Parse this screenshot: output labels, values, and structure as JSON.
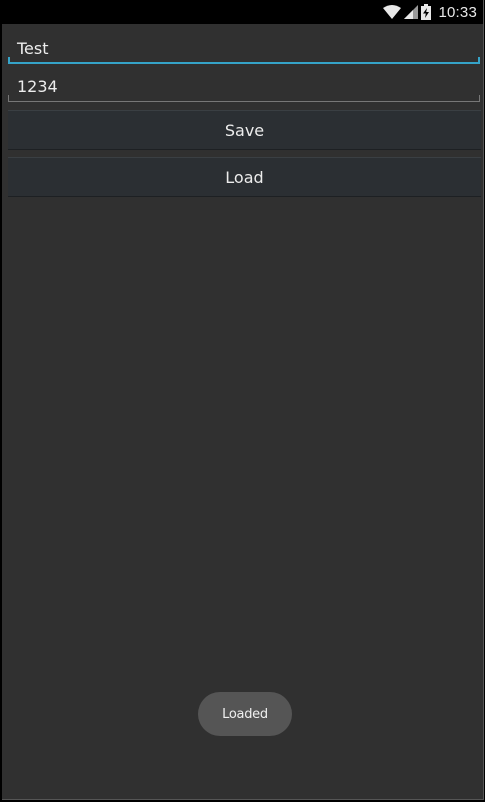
{
  "status_bar": {
    "time": "10:33",
    "icons": [
      "wifi-icon",
      "signal-icon",
      "battery-icon"
    ]
  },
  "form": {
    "name_value": "Test",
    "number_value": "1234"
  },
  "buttons": {
    "save_label": "Save",
    "load_label": "Load"
  },
  "toast": {
    "message": "Loaded"
  },
  "colors": {
    "background": "#303030",
    "status_bar": "#000000",
    "accent": "#35a3c8",
    "button": "#2b2f33",
    "toast": "#555555"
  }
}
